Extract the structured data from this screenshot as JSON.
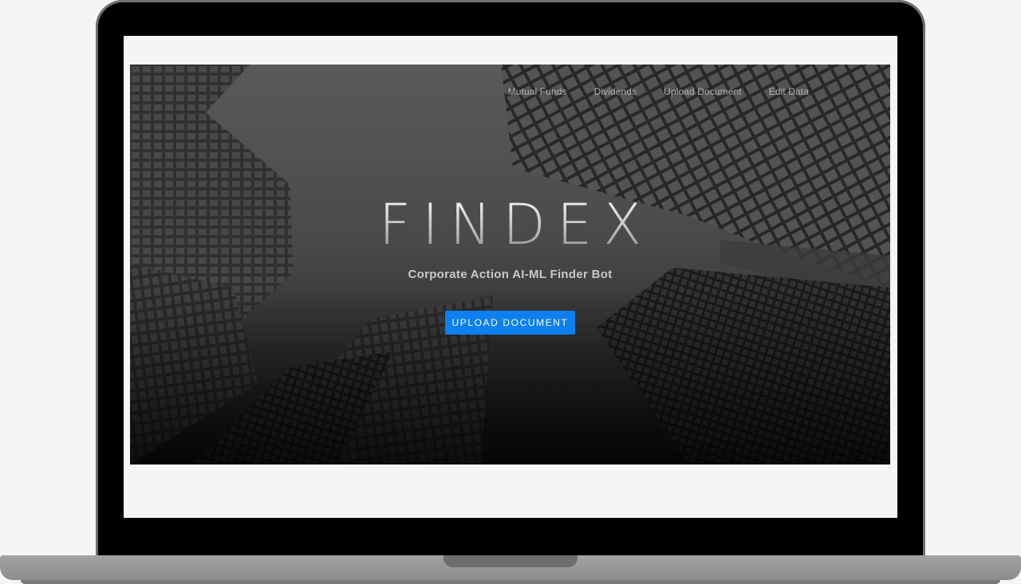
{
  "nav": {
    "items": [
      {
        "label": "Mutual Funds"
      },
      {
        "label": "Dividends"
      },
      {
        "label": "Upload Document"
      },
      {
        "label": "Edit Data"
      }
    ]
  },
  "hero": {
    "brand": "FINDEX",
    "tagline": "Corporate Action AI-ML Finder Bot",
    "cta_label": "UPLOAD DOCUMENT"
  },
  "colors": {
    "accent": "#0d7ff0",
    "hero_overlay": "#1a1a1a"
  }
}
